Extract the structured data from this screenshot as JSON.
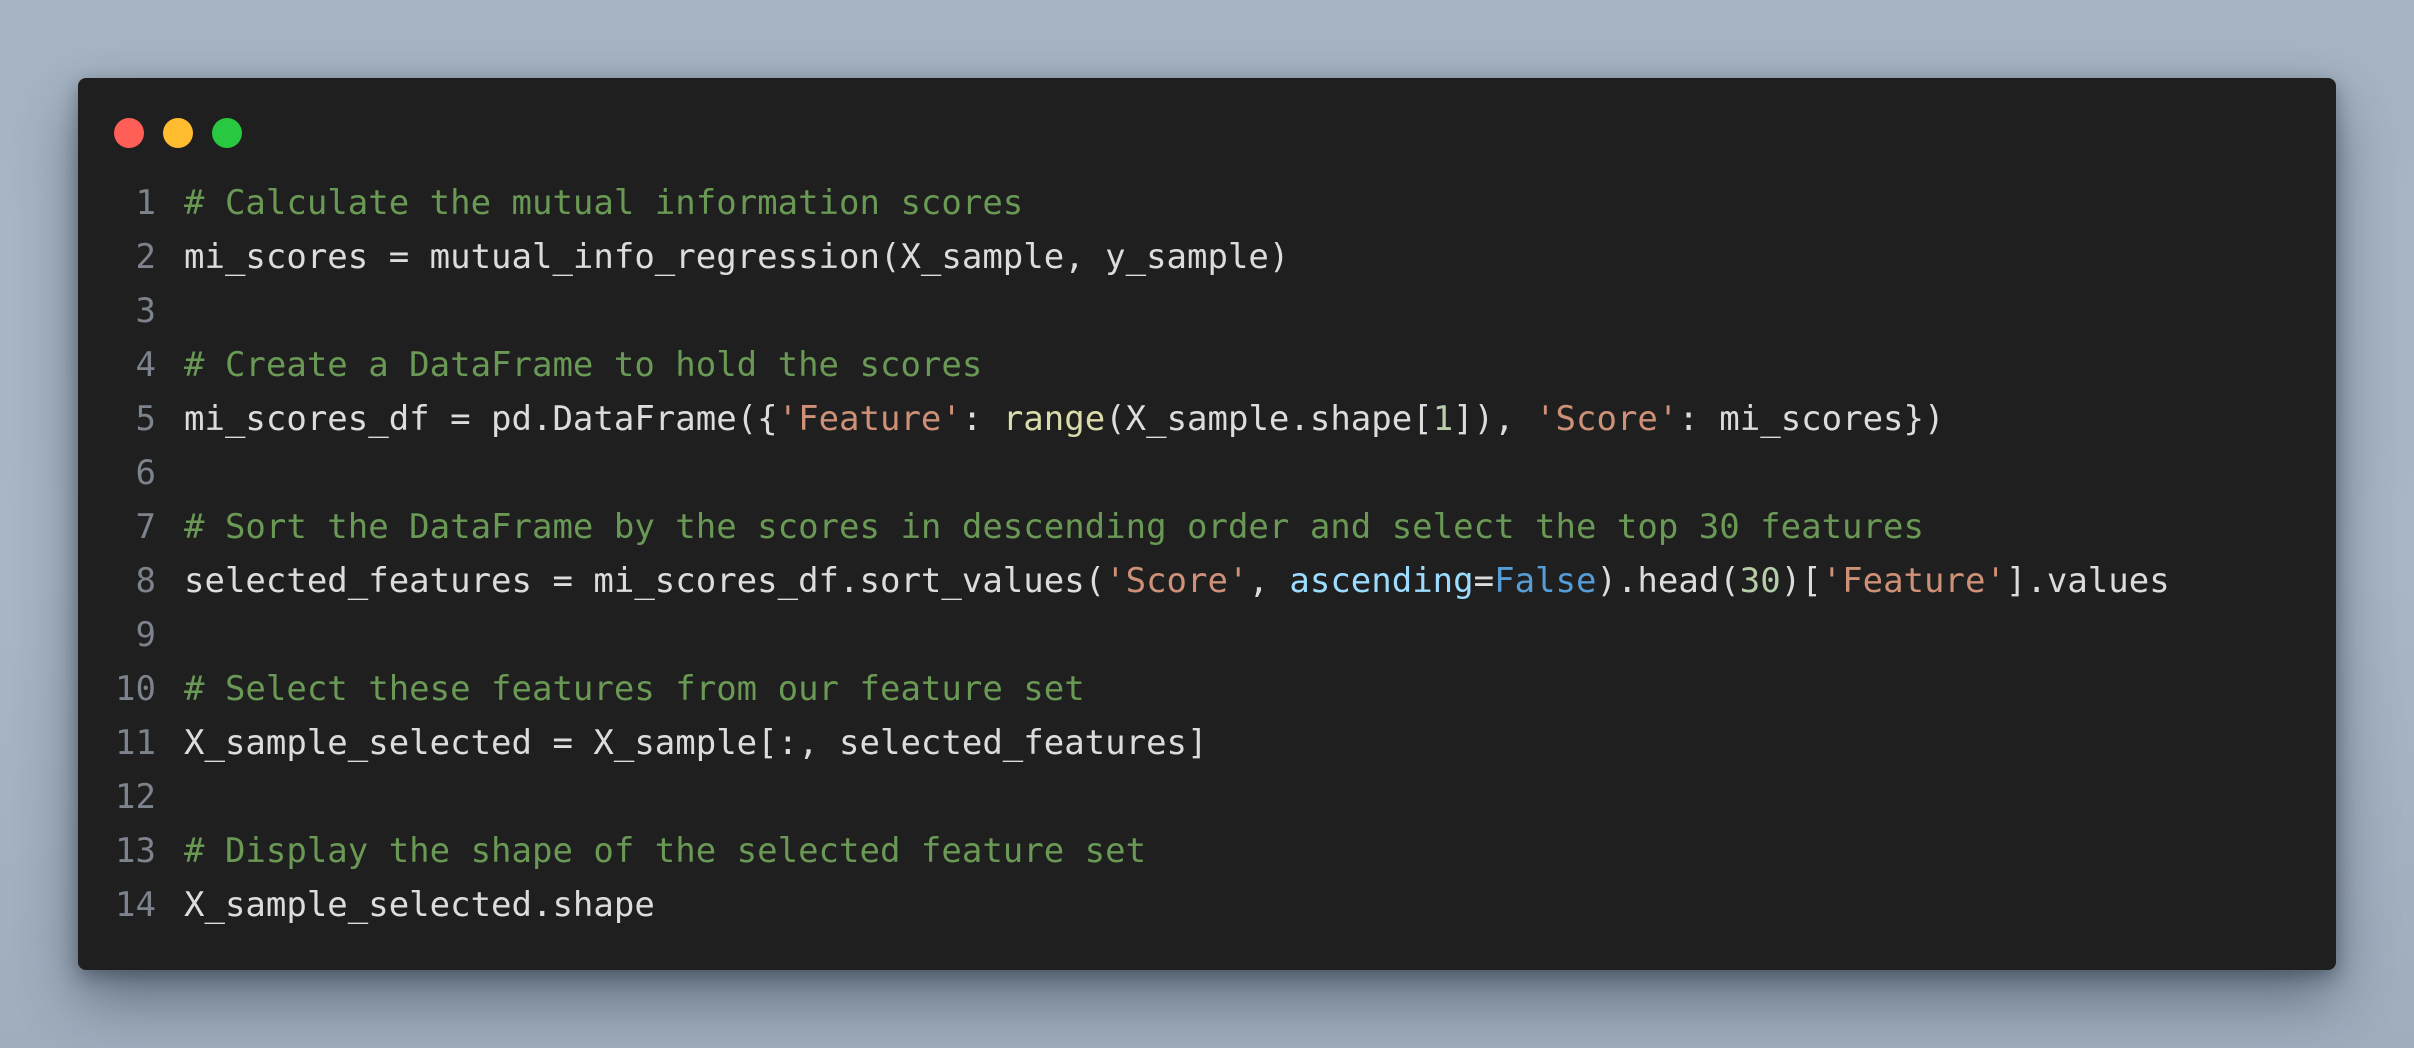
{
  "window": {
    "controls": [
      {
        "name": "close",
        "color": "#ff5f57"
      },
      {
        "name": "minimize",
        "color": "#febc2e"
      },
      {
        "name": "zoom",
        "color": "#28c840"
      }
    ]
  },
  "code": {
    "lines": [
      {
        "number": "1",
        "tokens": [
          {
            "t": "comment",
            "text": "# Calculate the mutual information scores"
          }
        ]
      },
      {
        "number": "2",
        "tokens": [
          {
            "t": "plain",
            "text": "mi_scores = mutual_info_regression(X_sample, y_sample)"
          }
        ]
      },
      {
        "number": "3",
        "tokens": []
      },
      {
        "number": "4",
        "tokens": [
          {
            "t": "comment",
            "text": "# Create a DataFrame to hold the scores"
          }
        ]
      },
      {
        "number": "5",
        "tokens": [
          {
            "t": "plain",
            "text": "mi_scores_df = pd.DataFrame({"
          },
          {
            "t": "string",
            "text": "'Feature'"
          },
          {
            "t": "plain",
            "text": ": "
          },
          {
            "t": "builtin",
            "text": "range"
          },
          {
            "t": "plain",
            "text": "(X_sample.shape["
          },
          {
            "t": "number",
            "text": "1"
          },
          {
            "t": "plain",
            "text": "]), "
          },
          {
            "t": "string",
            "text": "'Score'"
          },
          {
            "t": "plain",
            "text": ": mi_scores})"
          }
        ]
      },
      {
        "number": "6",
        "tokens": []
      },
      {
        "number": "7",
        "tokens": [
          {
            "t": "comment",
            "text": "# Sort the DataFrame by the scores in descending order and select the top 30 features"
          }
        ]
      },
      {
        "number": "8",
        "tokens": [
          {
            "t": "plain",
            "text": "selected_features = mi_scores_df.sort_values("
          },
          {
            "t": "string",
            "text": "'Score'"
          },
          {
            "t": "plain",
            "text": ", "
          },
          {
            "t": "param",
            "text": "ascending"
          },
          {
            "t": "plain",
            "text": "="
          },
          {
            "t": "const",
            "text": "False"
          },
          {
            "t": "plain",
            "text": ").head("
          },
          {
            "t": "number",
            "text": "30"
          },
          {
            "t": "plain",
            "text": ")["
          },
          {
            "t": "string",
            "text": "'Feature'"
          },
          {
            "t": "plain",
            "text": "].values"
          }
        ]
      },
      {
        "number": "9",
        "tokens": []
      },
      {
        "number": "10",
        "tokens": [
          {
            "t": "comment",
            "text": "# Select these features from our feature set"
          }
        ]
      },
      {
        "number": "11",
        "tokens": [
          {
            "t": "plain",
            "text": "X_sample_selected = X_sample[:, selected_features]"
          }
        ]
      },
      {
        "number": "12",
        "tokens": []
      },
      {
        "number": "13",
        "tokens": [
          {
            "t": "comment",
            "text": "# Display the shape of the selected feature set"
          }
        ]
      },
      {
        "number": "14",
        "tokens": [
          {
            "t": "plain",
            "text": "X_sample_selected.shape"
          }
        ]
      }
    ]
  },
  "colors": {
    "background": "#a8b6c5",
    "editor": "#1f1f1f",
    "comment": "#6a9955",
    "string": "#ce9178",
    "builtin": "#dcdcaa",
    "number": "#b5cea8",
    "param": "#9cdcfe",
    "const": "#569cd6",
    "plain": "#dcdcdc",
    "line_number": "#7d838c"
  }
}
